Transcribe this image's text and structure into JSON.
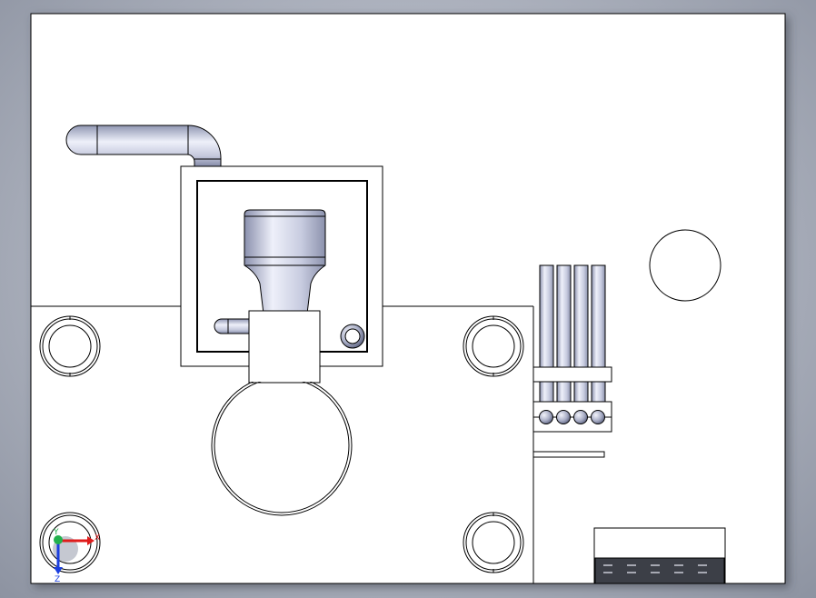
{
  "view": {
    "background_color": "#b4b8c3",
    "sheet_color": "#ffffff",
    "edge_color": "#000000",
    "shade_light": "#f2f4fb",
    "shade_mid": "#c3c8dc",
    "shade_dark": "#7f86a3"
  },
  "triad": {
    "x_label": "X",
    "y_label": "Y",
    "z_label": "Z",
    "x_color": "#e01b1b",
    "y_color": "#22b14c",
    "z_color": "#1b3fe0"
  },
  "parts": [
    {
      "name": "base-plate",
      "icon": "rectangle"
    },
    {
      "name": "elbow-pipe",
      "icon": "pipe-elbow"
    },
    {
      "name": "square-housing",
      "icon": "square-frame"
    },
    {
      "name": "funnel-nozzle",
      "icon": "nozzle"
    },
    {
      "name": "round-opening",
      "icon": "circle"
    },
    {
      "name": "vertical-tube-bundle",
      "icon": "tubes"
    },
    {
      "name": "vent-grille",
      "icon": "grille"
    }
  ]
}
